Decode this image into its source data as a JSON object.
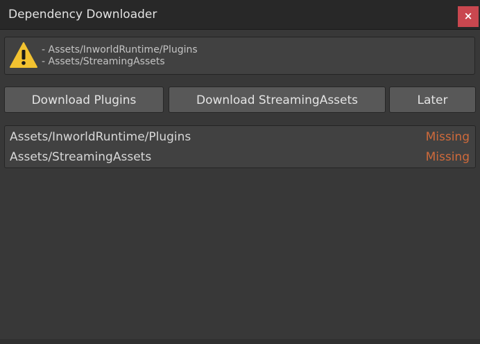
{
  "window": {
    "title": "Dependency Downloader",
    "close_label": "×"
  },
  "warning": {
    "icon": "warning-triangle-icon",
    "lines": [
      "- Assets/InworldRuntime/Plugins",
      "- Assets/StreamingAssets"
    ]
  },
  "buttons": {
    "download_plugins": "Download Plugins",
    "download_streaming_assets": "Download StreamingAssets",
    "later": "Later"
  },
  "status_list": [
    {
      "path": "Assets/InworldRuntime/Plugins",
      "status": "Missing"
    },
    {
      "path": "Assets/StreamingAssets",
      "status": "Missing"
    }
  ],
  "colors": {
    "background": "#383838",
    "titlebar": "#282828",
    "close_button": "#c9474f",
    "missing": "#cf6a3b",
    "warning_icon": "#f2c230"
  }
}
